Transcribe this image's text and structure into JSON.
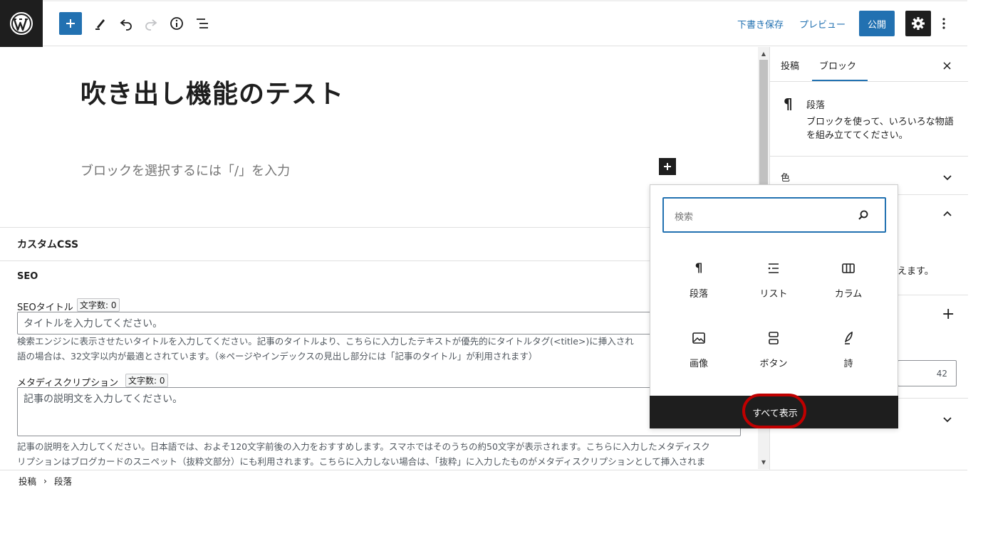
{
  "toolbar": {
    "save_draft": "下書き保存",
    "preview": "プレビュー",
    "publish": "公開"
  },
  "editor": {
    "post_title": "吹き出し機能のテスト",
    "block_placeholder": "ブロックを選択するには「/」を入力"
  },
  "meta": {
    "custom_css_title": "カスタムCSS",
    "seo_title": "SEO",
    "seo_title_label": "SEOタイトル",
    "seo_title_count": "文字数: 0",
    "seo_title_placeholder": "タイトルを入力してください。",
    "seo_title_help_1": "検索エンジンに表示させたいタイトルを入力してください。記事のタイトルより、こちらに入力したテキストが優先的にタイトルタグ(<title>)に挿入され",
    "seo_title_help_2": "語の場合は、32文字以内が最適とされています。（※ページやインデックスの見出し部分には「記事のタイトル」が利用されます）",
    "meta_desc_label": "メタディスクリプション",
    "meta_desc_count": "文字数: 0",
    "meta_desc_placeholder": "記事の説明文を入力してください。",
    "meta_desc_help_1": "記事の説明を入力してください。日本語では、およそ120文字前後の入力をおすすめします。スマホではそのうちの約50文字が表示されます。こちらに入力したメタディスク",
    "meta_desc_help_2": "リプションはブログカードのスニペット（抜粋文部分）にも利用されます。こちらに入力しない場合は、「抜粋」に入力したものがメタディスクリプションとして挿入されま"
  },
  "breadcrumb": {
    "items": [
      "投稿",
      "段落"
    ],
    "separator": "›"
  },
  "sidebar": {
    "tabs": [
      "投稿",
      "ブロック"
    ],
    "active_tab": "ブロック",
    "close": "×",
    "block_name": "段落",
    "block_description": "ブロックを使って、いろいろな物語を組み立ててください。",
    "panel_color": "色",
    "partial_text": "えます。",
    "number_value": "42"
  },
  "inserter": {
    "search_placeholder": "検索",
    "items": [
      {
        "label": "段落",
        "icon": "paragraph-icon"
      },
      {
        "label": "リスト",
        "icon": "list-icon"
      },
      {
        "label": "カラム",
        "icon": "columns-icon"
      },
      {
        "label": "画像",
        "icon": "image-icon"
      },
      {
        "label": "ボタン",
        "icon": "buttons-icon"
      },
      {
        "label": "詩",
        "icon": "verse-icon"
      }
    ],
    "show_all": "すべて表示"
  },
  "colors": {
    "accent": "#2271b1",
    "dark": "#1e1e1e",
    "highlight": "#c00000"
  }
}
